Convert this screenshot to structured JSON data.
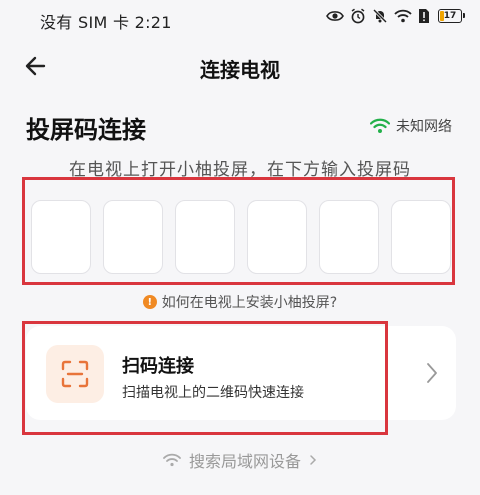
{
  "status_bar": {
    "carrier_time": "没有 SIM 卡 2:21",
    "battery_level": "17"
  },
  "header": {
    "title": "连接电视"
  },
  "section": {
    "title": "投屏码连接",
    "network_label": "未知网络",
    "instruction": "在电视上打开小柚投屏，在下方输入投屏码"
  },
  "code_inputs": [
    "",
    "",
    "",
    "",
    "",
    ""
  ],
  "help": {
    "icon": "!",
    "label": "如何在电视上安装小柚投屏?"
  },
  "scan_card": {
    "title": "扫码连接",
    "description": "扫描电视上的二维码快速连接"
  },
  "lan_search": {
    "label": "搜索局域网设备"
  },
  "colors": {
    "accent_green": "#22b04a",
    "accent_orange": "#e8743a",
    "highlight_red": "#d9363e"
  }
}
